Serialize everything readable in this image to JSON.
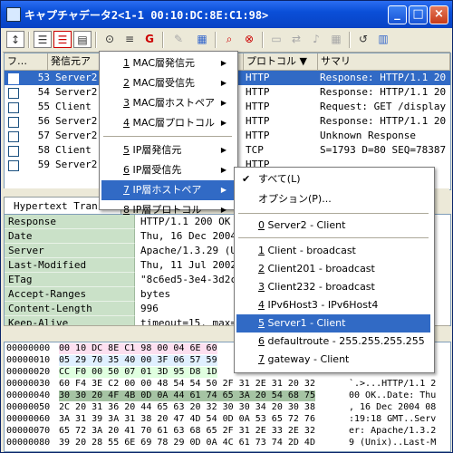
{
  "window": {
    "title": "キャプチャデータ2<1-1 00:10:DC:8E:C1:98>"
  },
  "toolbar": {
    "icons": [
      "mark-icon",
      "list-view-icon",
      "split-view-icon",
      "hex-view-icon",
      "filter-menu-icon",
      "filter-icon",
      "gear-icon",
      "brush-icon",
      "view-icon",
      "search-icon",
      "stop-icon",
      "panel-icon",
      "compare-icon",
      "speaker-icon",
      "grid-icon",
      "export-icon",
      "graph-icon"
    ]
  },
  "list": {
    "columns": [
      "フ…",
      "発信元ア",
      "",
      "プロトコル",
      "サマリ"
    ],
    "rows": [
      {
        "no": "53",
        "src": "Server2",
        "proto": "HTTP",
        "summary": "Response: HTTP/1.1 20",
        "selected": true
      },
      {
        "no": "54",
        "src": "Server2",
        "proto": "HTTP",
        "summary": "Response: HTTP/1.1 20",
        "selected": false
      },
      {
        "no": "55",
        "src": "Client",
        "proto": "HTTP",
        "summary": "Request: GET /display",
        "selected": false
      },
      {
        "no": "56",
        "src": "Server2",
        "proto": "HTTP",
        "summary": "Response: HTTP/1.1 20",
        "selected": false
      },
      {
        "no": "57",
        "src": "Server2",
        "proto": "HTTP",
        "summary": "Unknown Response",
        "selected": false
      },
      {
        "no": "58",
        "src": "Client",
        "proto": "TCP",
        "summary": "S=1793 D=80 SEQ=78387",
        "selected": false
      },
      {
        "no": "59",
        "src": "Server2",
        "proto": "HTTP",
        "summary": "",
        "selected": false
      }
    ]
  },
  "detail": {
    "tab": "Hypertext Transf",
    "rows": [
      {
        "k": "Response",
        "v": "HTTP/1.1 200 OK"
      },
      {
        "k": "Date",
        "v": "Thu, 16 Dec 2004 08"
      },
      {
        "k": "Server",
        "v": "Apache/1.3.29 (U"
      },
      {
        "k": "Last-Modified",
        "v": "Thu, 11 Jul 2002"
      },
      {
        "k": "ETag",
        "v": "\"8c6ed5-3e4-3d2c"
      },
      {
        "k": "Accept-Ranges",
        "v": "bytes"
      },
      {
        "k": "Content-Length",
        "v": "996"
      },
      {
        "k": "Keep-Alive",
        "v": "timeout=15, max="
      }
    ]
  },
  "hex": {
    "rows": [
      {
        "off": "00000000",
        "bytes": "00 10 DC 8E  C1 98 00 04  6E 60",
        "asc": ""
      },
      {
        "off": "00000010",
        "bytes": "05 29 70 35  40 00 3F 06  57 59",
        "asc": ""
      },
      {
        "off": "00000020",
        "bytes": "CC F0 00 50  07 01 3D 95  D8 1D",
        "asc": ""
      },
      {
        "off": "00000030",
        "bytes": "60 F4 3E C2  00 00 48 54  54 50  2F 31  2E 31 20 32",
        "asc": "`.>...HTTP/1.1 2"
      },
      {
        "off": "00000040",
        "bytes": "30 30 20 4F  4B 0D 0A 44  61 74 65 3A  20 54 68 75",
        "asc": "00 OK..Date: Thu"
      },
      {
        "off": "00000050",
        "bytes": "2C 20 31 36  20 44 65 63  20 32 30 30  34 20 30 38",
        "asc": ", 16 Dec 2004 08"
      },
      {
        "off": "00000060",
        "bytes": "3A 31 39 3A  31 38 20 47  4D 54 0D 0A  53 65 72 76",
        "asc": ":19:18 GMT..Serv"
      },
      {
        "off": "00000070",
        "bytes": "65 72 3A 20  41 70 61 63  68 65 2F 31  2E 33 2E 32",
        "asc": "er: Apache/1.3.2"
      },
      {
        "off": "00000080",
        "bytes": "39 20 28 55  6E 69 78 29  0D 0A 4C 61  73 74 2D 4D",
        "asc": "9 (Unix)..Last-M"
      }
    ]
  },
  "menu": {
    "items": [
      {
        "num": "1",
        "label": "MAC層発信元"
      },
      {
        "num": "2",
        "label": "MAC層受信先"
      },
      {
        "num": "3",
        "label": "MAC層ホストペア"
      },
      {
        "num": "4",
        "label": "MAC層プロトコル"
      },
      {
        "num": "5",
        "label": "IP層発信元"
      },
      {
        "num": "6",
        "label": "IP層受信先"
      },
      {
        "num": "7",
        "label": "IP層ホストペア"
      },
      {
        "num": "8",
        "label": "IP層プロトコル"
      }
    ]
  },
  "submenu": {
    "all": "すべて(L)",
    "options": "オプション(P)...",
    "items": [
      {
        "num": "0",
        "label": "Server2 - Client"
      },
      {
        "num": "1",
        "label": "Client - broadcast"
      },
      {
        "num": "2",
        "label": "Client201 - broadcast"
      },
      {
        "num": "3",
        "label": "Client232 - broadcast"
      },
      {
        "num": "4",
        "label": "IPv6Host3 - IPv6Host4"
      },
      {
        "num": "5",
        "label": "Server1 - Client"
      },
      {
        "num": "6",
        "label": "defaultroute - 255.255.255.255"
      },
      {
        "num": "7",
        "label": "gateway - Client"
      }
    ]
  }
}
